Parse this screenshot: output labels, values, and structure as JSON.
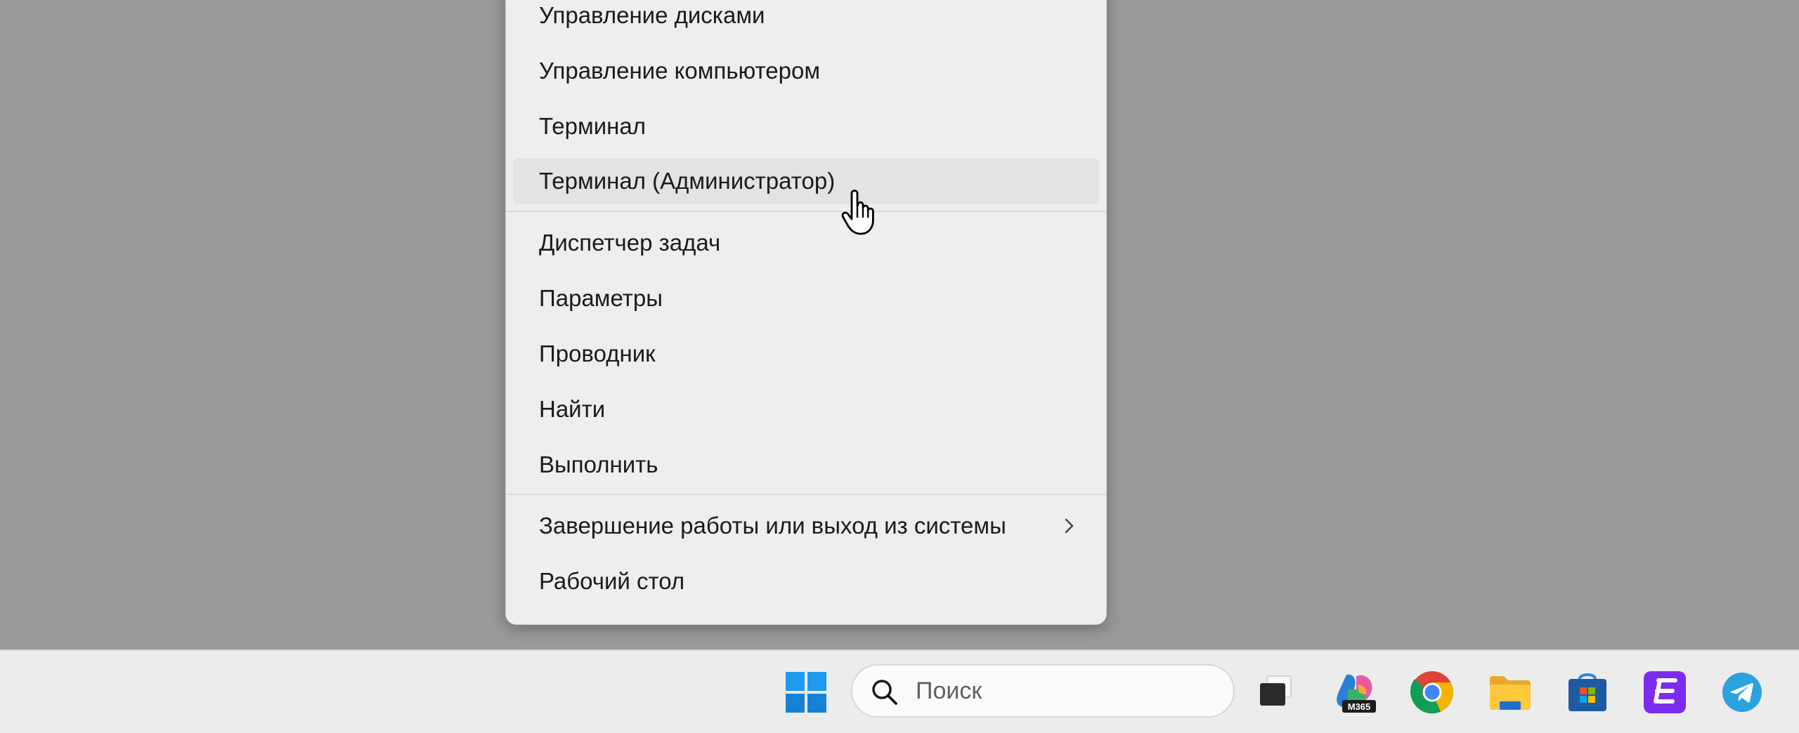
{
  "menu": {
    "items": [
      {
        "label": "Управление дисками"
      },
      {
        "label": "Управление компьютером"
      },
      {
        "label": "Терминал"
      },
      {
        "label": "Терминал (Администратор)"
      },
      {
        "label": "Диспетчер задач"
      },
      {
        "label": "Параметры"
      },
      {
        "label": "Проводник"
      },
      {
        "label": "Найти"
      },
      {
        "label": "Выполнить"
      },
      {
        "label": "Завершение работы или выход из системы"
      },
      {
        "label": "Рабочий стол"
      }
    ],
    "hovered_item": "Терминал (Администратор)"
  },
  "taskbar": {
    "search": {
      "placeholder": "Поиск"
    },
    "icons": [
      "windows-start-icon",
      "task-view-icon",
      "microsoft-365-copilot-icon",
      "chrome-icon",
      "file-explorer-icon",
      "microsoft-store-icon",
      "e-app-icon",
      "telegram-icon"
    ],
    "m365_badge": "M365"
  }
}
